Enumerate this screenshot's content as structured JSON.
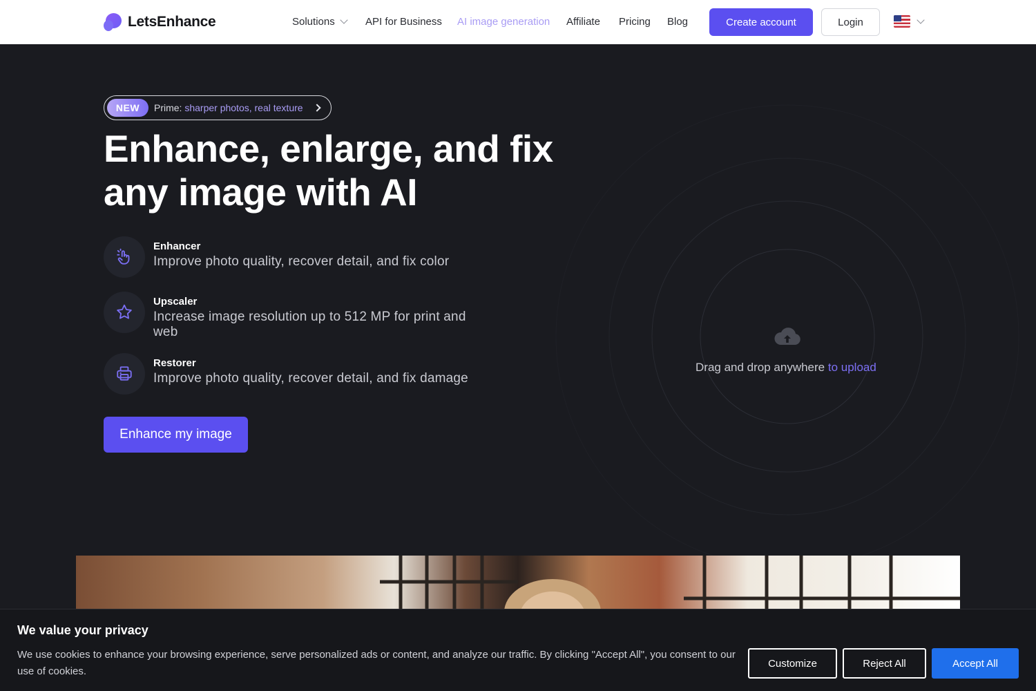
{
  "header": {
    "brand": "LetsEnhance",
    "nav": [
      {
        "label": "Solutions"
      },
      {
        "label": "API for Business"
      },
      {
        "label": "AI image generation"
      },
      {
        "label": "Affiliate"
      },
      {
        "label": "Pricing"
      },
      {
        "label": "Blog"
      }
    ],
    "create_account": "Create account",
    "login": "Login",
    "language_icon": "us-flag-icon"
  },
  "hero": {
    "badge_new": "NEW",
    "badge_prefix": "Prime:",
    "badge_highlight": "sharper photos, real texture",
    "title_line1": "Enhance, enlarge, and fix",
    "title_line2": "any image with AI",
    "features": [
      {
        "title": "Enhancer",
        "description": "Improve photo quality, recover detail, and fix color",
        "icon": "hand-tap-icon"
      },
      {
        "title": "Upscaler",
        "description": "Increase image resolution up to 512 MP for print and web",
        "icon": "star-icon"
      },
      {
        "title": "Restorer",
        "description": "Improve photo quality, recover detail, and fix damage",
        "icon": "printer-icon"
      }
    ],
    "cta": "Enhance my image"
  },
  "upload": {
    "text": "Drag and drop anywhere",
    "link": "to upload",
    "icon": "cloud-upload-icon"
  },
  "cookie": {
    "title": "We value your privacy",
    "text": "We use cookies to enhance your browsing experience, serve personalized ads or content, and analyze our traffic. By clicking \"Accept All\", you consent to our use of cookies.",
    "customize": "Customize",
    "reject": "Reject All",
    "accept": "Accept All"
  },
  "colors": {
    "accent": "#5b4ff0",
    "accent_light": "#a99cf4",
    "background": "#1a1b20",
    "accept_blue": "#1f6feb"
  }
}
